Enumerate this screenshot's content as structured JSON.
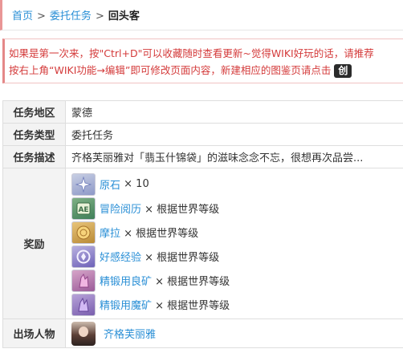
{
  "breadcrumb": {
    "home": "首页",
    "sep": ">",
    "category": "委托任务",
    "current": "回头客"
  },
  "notice": {
    "line1": "如果是第一次来，按\"Ctrl+D\"可以收藏随时查看更新~觉得WIKI好玩的话，请推荐",
    "line2": "按右上角“WIKI功能→编辑”即可修改页面内容，新建相应的图鉴页请点击",
    "button": "创"
  },
  "info": {
    "region_label": "任务地区",
    "region_value": "蒙德",
    "type_label": "任务类型",
    "type_value": "委托任务",
    "desc_label": "任务描述",
    "desc_value": "齐格芙丽雅对「翡玉什锦袋」的滋味念念不忘，很想再次品尝...",
    "reward_label": "奖励",
    "char_label": "出场人物"
  },
  "rewards": [
    {
      "name": "原石",
      "qty": "× 10",
      "icon": "primogem-icon"
    },
    {
      "name": "冒险阅历",
      "qty": "× 根据世界等级",
      "icon": "adventure-exp-icon"
    },
    {
      "name": "摩拉",
      "qty": "× 根据世界等级",
      "icon": "mora-icon"
    },
    {
      "name": "好感经验",
      "qty": "× 根据世界等级",
      "icon": "friendship-exp-icon"
    },
    {
      "name": "精锻用良矿",
      "qty": "× 根据世界等级",
      "icon": "fine-enhancement-ore-icon"
    },
    {
      "name": "精锻用魔矿",
      "qty": "× 根据世界等级",
      "icon": "mystic-enhancement-ore-icon"
    }
  ],
  "character": {
    "name": "齐格芙丽雅",
    "icon": "character-avatar"
  },
  "colors": {
    "link": "#2a8fd6",
    "notice_text": "#d43b3b",
    "label_bg": "#f3f3f3",
    "accent_border": "#e99696"
  }
}
